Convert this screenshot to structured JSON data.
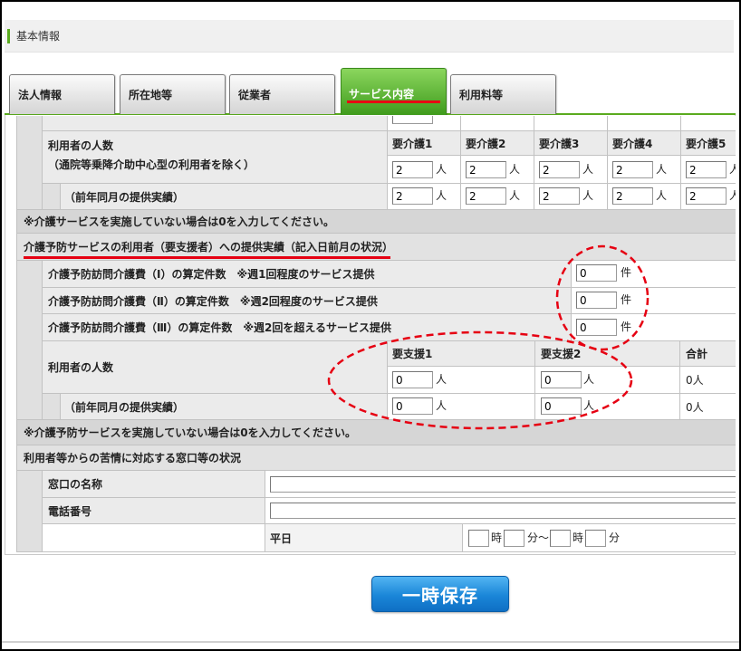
{
  "header": {
    "title": "基本情報"
  },
  "tabs": [
    {
      "label": "法人情報"
    },
    {
      "label": "所在地等"
    },
    {
      "label": "従業者"
    },
    {
      "label": "サービス内容",
      "active": true
    },
    {
      "label": "利用料等"
    }
  ],
  "care": {
    "users_label": "利用者の人数",
    "users_note": "（通院等乗降介助中心型の利用者を除く）",
    "columns": [
      "要介護1",
      "要介護2",
      "要介護3",
      "要介護4",
      "要介護5"
    ],
    "current": [
      "2",
      "2",
      "2",
      "2",
      "2"
    ],
    "previous_label": "（前年同月の提供実績）",
    "previous": [
      "2",
      "2",
      "2",
      "2",
      "2"
    ],
    "unit": "人",
    "note": "※介護サービスを実施していない場合は0を入力してください。"
  },
  "prevention": {
    "heading": "介護予防サービスの利用者（要支援者）への提供実績（記入日前月の状況）",
    "counts": [
      {
        "label": "介護予防訪問介護費（Ⅰ）の算定件数　※週1回程度のサービス提供",
        "value": "0"
      },
      {
        "label": "介護予防訪問介護費（Ⅱ）の算定件数　※週2回程度のサービス提供",
        "value": "0"
      },
      {
        "label": "介護予防訪問介護費（Ⅲ）の算定件数　※週2回を超えるサービス提供",
        "value": "0"
      }
    ],
    "count_unit": "件",
    "users_label": "利用者の人数",
    "columns": [
      "要支援1",
      "要支援2",
      "合計"
    ],
    "current": [
      "0",
      "0"
    ],
    "current_total": "0人",
    "previous_label": "（前年同月の提供実績）",
    "previous": [
      "0",
      "0"
    ],
    "previous_total": "0人",
    "unit": "人",
    "note": "※介護予防サービスを実施していない場合は0を入力してください。"
  },
  "complaints": {
    "heading": "利用者等からの苦情に対応する窓口等の状況",
    "window_name_label": "窓口の名称",
    "phone_label": "電話番号",
    "weekday_label": "平日",
    "hour_unit": "時",
    "minute_range_unit": "分～",
    "minute_unit": "分"
  },
  "actions": {
    "save_label": "一時保存"
  },
  "colors": {
    "accent_green": "#5aab1e",
    "annotation_red": "#e60012",
    "button_blue": "#1a86d8"
  }
}
